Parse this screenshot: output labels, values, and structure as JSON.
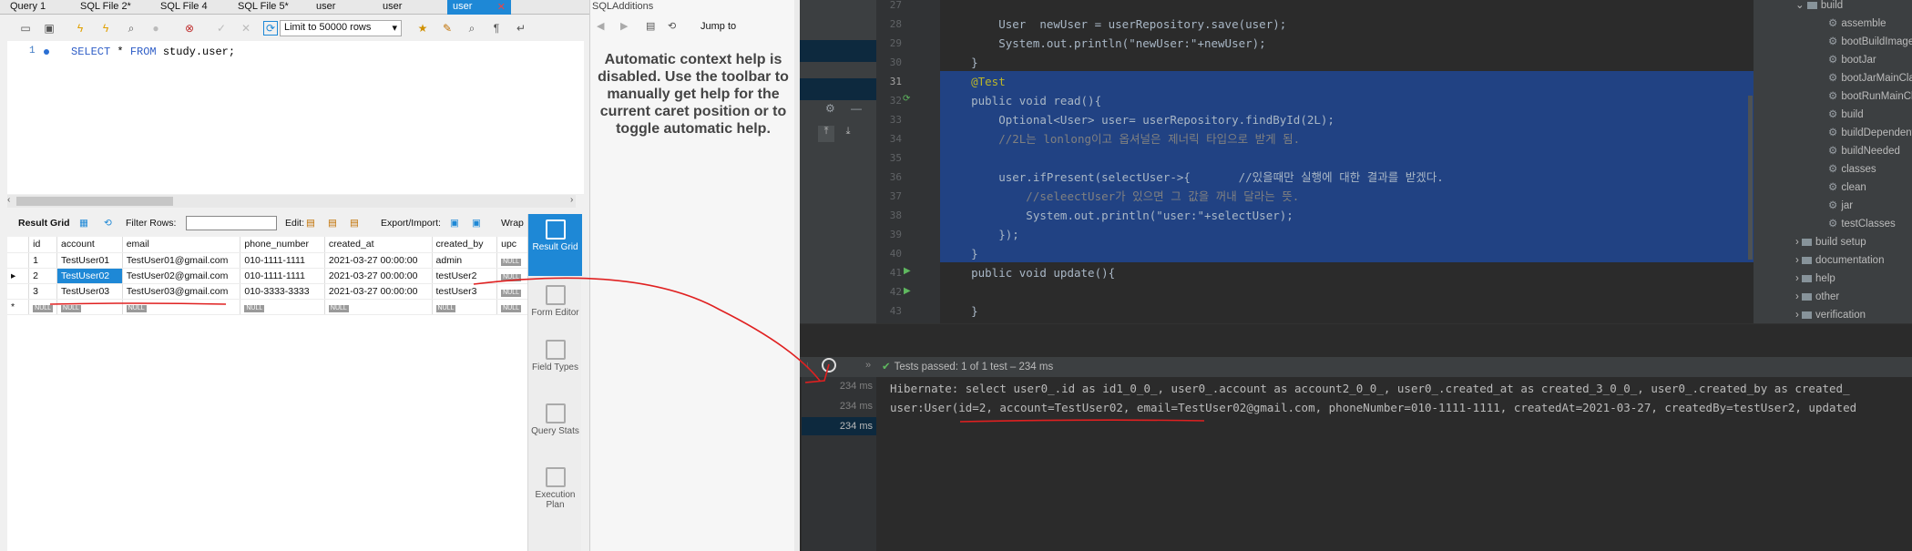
{
  "workbench": {
    "tabs": [
      "Query 1",
      "SQL File 2*",
      "SQL File 4",
      "SQL File 5*",
      "user",
      "user",
      "user"
    ],
    "active_tab_close": "✕",
    "limit_label": "Limit to 50000 rows",
    "editor": {
      "line_number": "1",
      "sql_kw1": "SELECT",
      "sql_star": " * ",
      "sql_kw2": "FROM",
      "sql_rest": " study.user;"
    },
    "result_toolbar": {
      "result_grid": "Result Grid",
      "filter_rows": "Filter Rows:",
      "edit": "Edit:",
      "export_import": "Export/Import:",
      "wrap": "Wrap"
    },
    "columns": [
      "id",
      "account",
      "email",
      "phone_number",
      "created_at",
      "created_by",
      "upc"
    ],
    "rows": [
      [
        "1",
        "TestUser01",
        "TestUser01@gmail.com",
        "010-1111-1111",
        "2021-03-27 00:00:00",
        "admin",
        "NULL"
      ],
      [
        "2",
        "TestUser02",
        "TestUser02@gmail.com",
        "010-1111-1111",
        "2021-03-27 00:00:00",
        "testUser2",
        "NULL"
      ],
      [
        "3",
        "TestUser03",
        "TestUser03@gmail.com",
        "010-3333-3333",
        "2021-03-27 00:00:00",
        "testUser3",
        "NULL"
      ]
    ],
    "new_row_marker": "*",
    "null_label": "NULL",
    "side_panel": [
      "Result Grid",
      "Form Editor",
      "Field Types",
      "Query Stats",
      "Execution Plan"
    ],
    "sql_additions": {
      "title": "SQLAdditions",
      "jump_to": "Jump to",
      "help_text": "Automatic context help is disabled. Use the toolbar to manually get help for the current caret position or to toggle automatic help."
    }
  },
  "ide": {
    "code_lines": [
      {
        "num": "27",
        "text": ""
      },
      {
        "num": "28",
        "text": "        User  newUser = userRepository.save(user);"
      },
      {
        "num": "29",
        "text": "        System.out.println(\"newUser:\"+newUser);"
      },
      {
        "num": "30",
        "text": "    }"
      },
      {
        "num": "31",
        "text": "    @Test"
      },
      {
        "num": "32",
        "text": "    public void read(){"
      },
      {
        "num": "33",
        "text": "        Optional<User> user= userRepository.findById(2L);"
      },
      {
        "num": "34",
        "text": "        //2L는 lonlong이고 옵셔널은 제너릭 타입으로 받게 됨."
      },
      {
        "num": "35",
        "text": ""
      },
      {
        "num": "36",
        "text": "        user.ifPresent(selectUser->{       //있을때만 실행에 대한 결과를 받겠다."
      },
      {
        "num": "37",
        "text": "            //seleectUser가 있으면 그 값을 꺼내 달라는 뜻."
      },
      {
        "num": "38",
        "text": "            System.out.println(\"user:\"+selectUser);"
      },
      {
        "num": "39",
        "text": "        });"
      },
      {
        "num": "40",
        "text": "    }"
      },
      {
        "num": "41",
        "text": "    public void update(){"
      },
      {
        "num": "42",
        "text": ""
      },
      {
        "num": "43",
        "text": "    }"
      }
    ],
    "project_tree": [
      "build",
      "assemble",
      "bootBuildImage",
      "bootJar",
      "bootJarMainClass",
      "bootRunMainClass",
      "build",
      "buildDependents",
      "buildNeeded",
      "classes",
      "clean",
      "jar",
      "testClasses",
      "build setup",
      "documentation",
      "help",
      "other",
      "verification"
    ],
    "run": {
      "status_prefix": "Tests passed:",
      "status_count": "1",
      "status_suffix": "of 1 test – 234 ms",
      "times": [
        "234 ms",
        "234 ms",
        "234 ms"
      ],
      "output": [
        "Hibernate: select user0_.id as id1_0_0_, user0_.account as account2_0_0_, user0_.created_at as created_3_0_0_, user0_.created_by as created_",
        "user:User(id=2, account=TestUser02, email=TestUser02@gmail.com, phoneNumber=010-1111-1111, createdAt=2021-03-27, createdBy=testUser2, updated"
      ]
    }
  },
  "colors": {
    "accent": "#1e88d6",
    "selection": "#214283",
    "annotation": "#e02020"
  }
}
